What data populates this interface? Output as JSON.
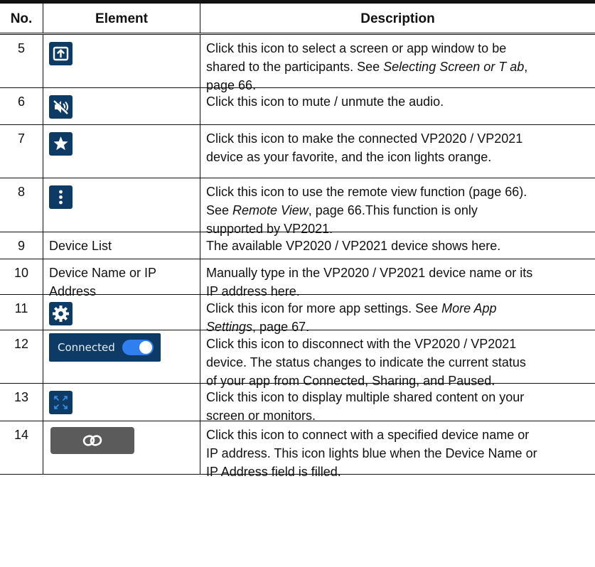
{
  "table": {
    "headers": {
      "no": "No.",
      "element": "Element",
      "description": "Description"
    },
    "rows": [
      {
        "no": "5",
        "element_icon": "screen-share-icon",
        "desc_lines": [
          "Click this icon to select a screen or app window to be",
          [
            "shared to the participants. See ",
            "Selecting Screen or T ab",
            ","
          ],
          "page 66."
        ]
      },
      {
        "no": "6",
        "element_icon": "mute-icon",
        "desc_lines": [
          "Click this icon to mute / unmute the audio."
        ]
      },
      {
        "no": "7",
        "element_icon": "star-icon",
        "desc_lines": [
          "Click this icon to make the connected VP2020 / VP2021",
          "device as your favorite, and the icon lights orange."
        ]
      },
      {
        "no": "8",
        "element_icon": "more-vertical-icon",
        "desc_lines": [
          "Click this icon to use the remote view function (page 66).",
          [
            "See ",
            "Remote View",
            ", page 66.This function is only"
          ],
          "supported by VP2021."
        ]
      },
      {
        "no": "9",
        "element_text": [
          "Device List"
        ],
        "desc_lines": [
          "The available VP2020 / VP2021 device shows here."
        ]
      },
      {
        "no": "10",
        "element_text": [
          "Device Name or IP",
          "Address"
        ],
        "desc_lines": [
          "Manually type in the VP2020 / VP2021 device name or its",
          "IP address here."
        ]
      },
      {
        "no": "11",
        "element_icon": "gear-icon",
        "desc_lines": [
          [
            "Click this icon for more app settings. See ",
            "More App",
            ""
          ],
          [
            "",
            "Settings",
            ", page 67."
          ]
        ]
      },
      {
        "no": "12",
        "element_icon": "connected-toggle-icon",
        "element_label": "Connected",
        "desc_lines": [
          "Click this icon to disconnect with the VP2020 / VP2021",
          "device. The status changes to indicate the current status",
          "of your app from Connected, Sharing, and Paused."
        ]
      },
      {
        "no": "13",
        "element_icon": "expand-icon",
        "desc_lines": [
          "Click this icon to display multiple shared content on your",
          "screen or monitors."
        ]
      },
      {
        "no": "14",
        "element_icon": "link-icon",
        "desc_lines": [
          "Click this icon to connect with a specified device name or",
          "IP address. This icon lights blue when the Device Name or",
          "IP Address field is filled."
        ]
      }
    ]
  },
  "colors": {
    "icon_tile": "#0e3a66",
    "toggle_on": "#2f7ff0",
    "link_button": "#5b5b5b"
  }
}
